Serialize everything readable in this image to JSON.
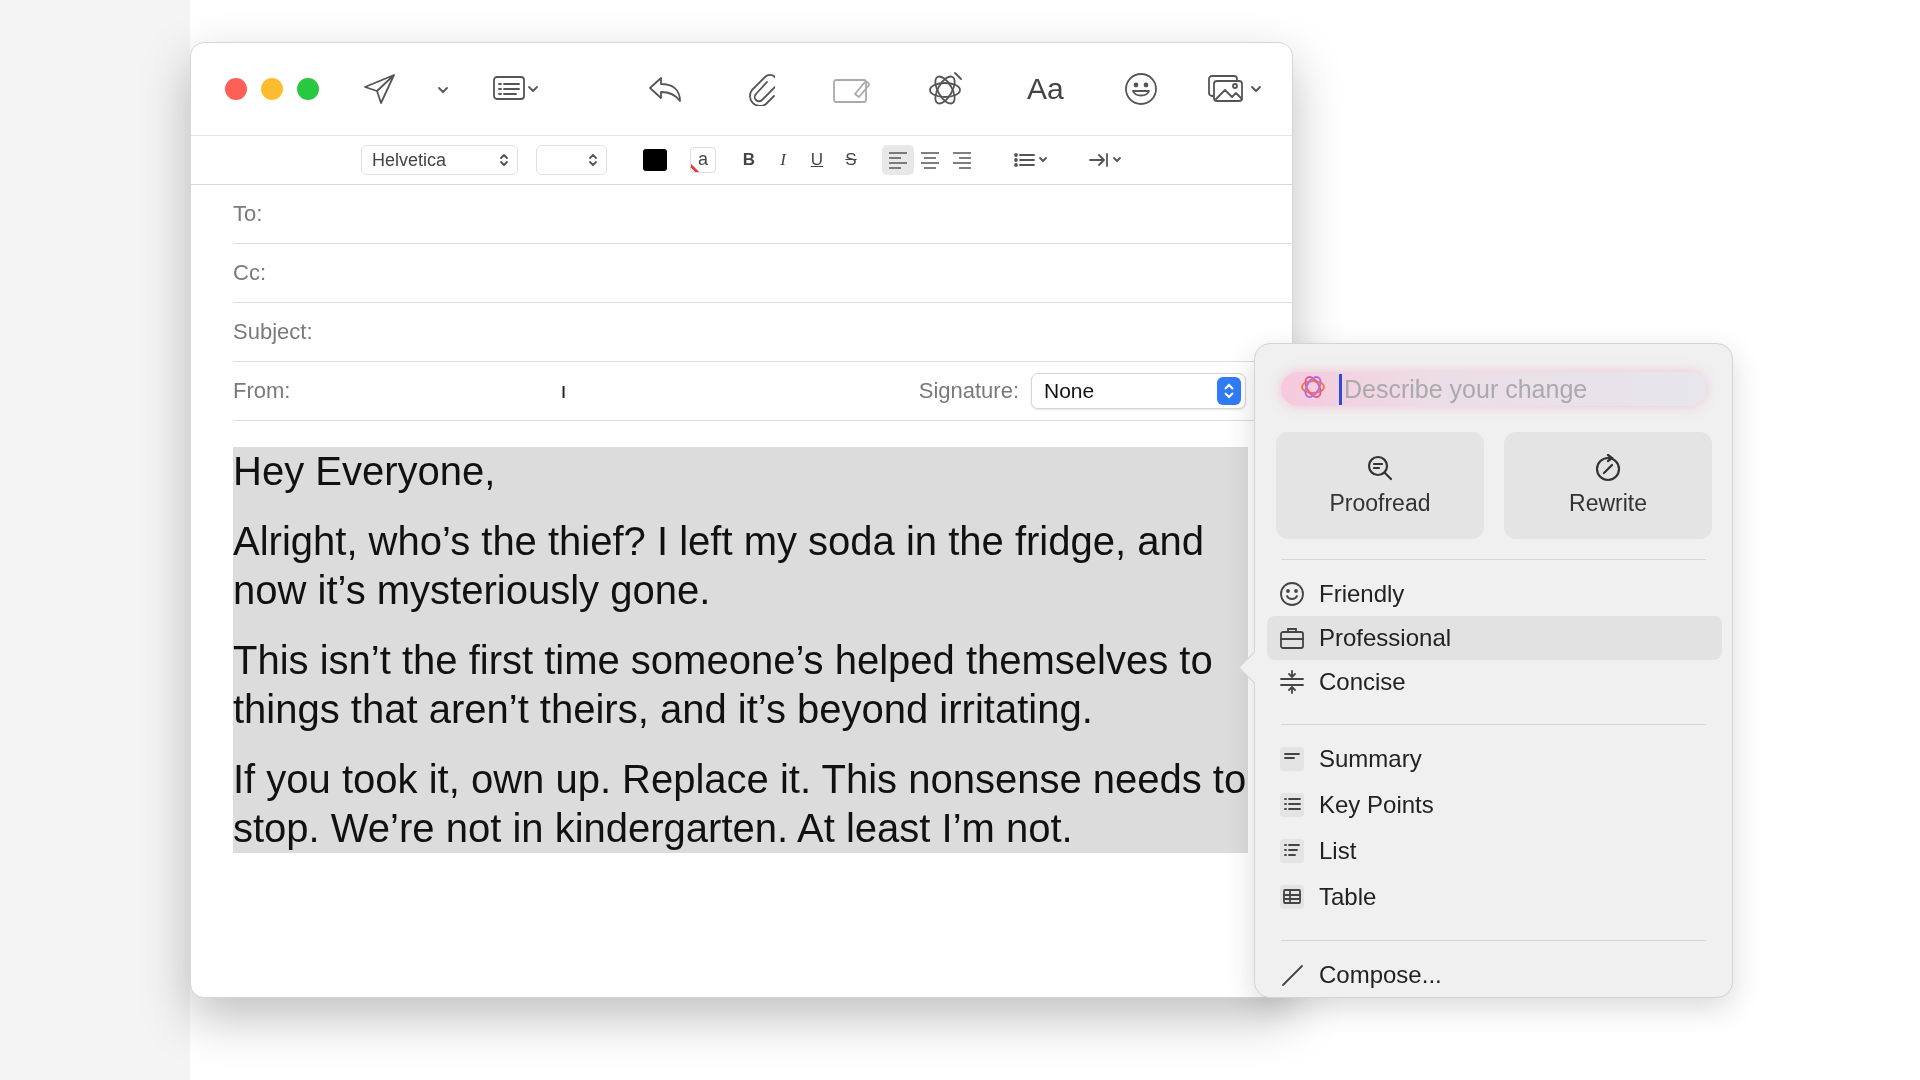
{
  "window": {
    "lights": [
      {
        "color": "#fe5f57"
      },
      {
        "color": "#febc2e"
      },
      {
        "color": "#28c840"
      }
    ]
  },
  "toolbar": {
    "font_button": "Aa"
  },
  "format_bar": {
    "font": "Helvetica",
    "highlight": "a",
    "styles": [
      "B",
      "I",
      "U",
      "S"
    ],
    "alignment": [
      {
        "selected": true
      },
      {
        "selected": false
      },
      {
        "selected": false
      }
    ]
  },
  "headers": [
    {
      "label": "To:"
    },
    {
      "label": "Cc:"
    },
    {
      "label": "Subject:"
    },
    {
      "label": "From:",
      "value": "ı"
    }
  ],
  "signature": {
    "label": "Signature:",
    "value": "None"
  },
  "body": {
    "paragraphs": [
      {
        "text": "Hey Everyone,",
        "selected": true
      },
      {
        "text": "Alright, who’s the thief? I left my soda in the fridge, and now it’s mysteriously gone.",
        "selected": true
      },
      {
        "text": "This isn’t the first time someone’s helped themselves to things that aren’t theirs, and it’s beyond irritating.",
        "selected": true
      },
      {
        "text": "If you took it, own up. Replace it. This nonsense needs to stop. We’re not in kindergarten. At least I’m not.",
        "selected": true
      }
    ]
  },
  "writing_tools": {
    "prompt": {
      "placeholder": "Describe your change"
    },
    "buttons": [
      "Proofread",
      "Rewrite"
    ],
    "groups": [
      [
        {
          "label": "Friendly",
          "selected": false
        },
        {
          "label": "Professional",
          "selected": true
        },
        {
          "label": "Concise",
          "selected": false
        }
      ],
      [
        {
          "label": "Summary",
          "selected": false
        },
        {
          "label": "Key Points",
          "selected": false
        },
        {
          "label": "List",
          "selected": false
        },
        {
          "label": "Table",
          "selected": false
        }
      ],
      [
        {
          "label": "Compose...",
          "selected": false
        }
      ]
    ]
  }
}
